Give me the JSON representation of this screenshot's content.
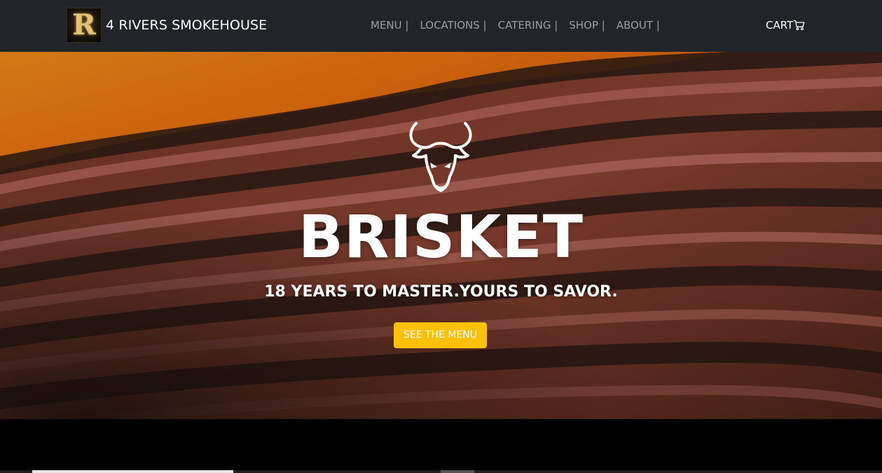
{
  "navbar": {
    "brand_logo_letter": "R",
    "brand_name": "4 RIVERS SMOKEHOUSE",
    "links": [
      {
        "label": "MENU |"
      },
      {
        "label": "LOCATIONS |"
      },
      {
        "label": "CATERING |"
      },
      {
        "label": "SHOP |"
      },
      {
        "label": "ABOUT |"
      }
    ],
    "cart_label": "CART",
    "cart_icon": "shopping-cart-icon"
  },
  "hero": {
    "icon": "bull-head-icon",
    "title": "BRISKET",
    "subtitle": "18 YEARS TO MASTER.YOURS TO SAVOR.",
    "button_label": "SEE THE MENU"
  },
  "colors": {
    "navbar_bg": "#212529",
    "button_bg": "#ffc107",
    "nav_link": "rgba(255,255,255,0.55)",
    "text_white": "#ffffff"
  }
}
